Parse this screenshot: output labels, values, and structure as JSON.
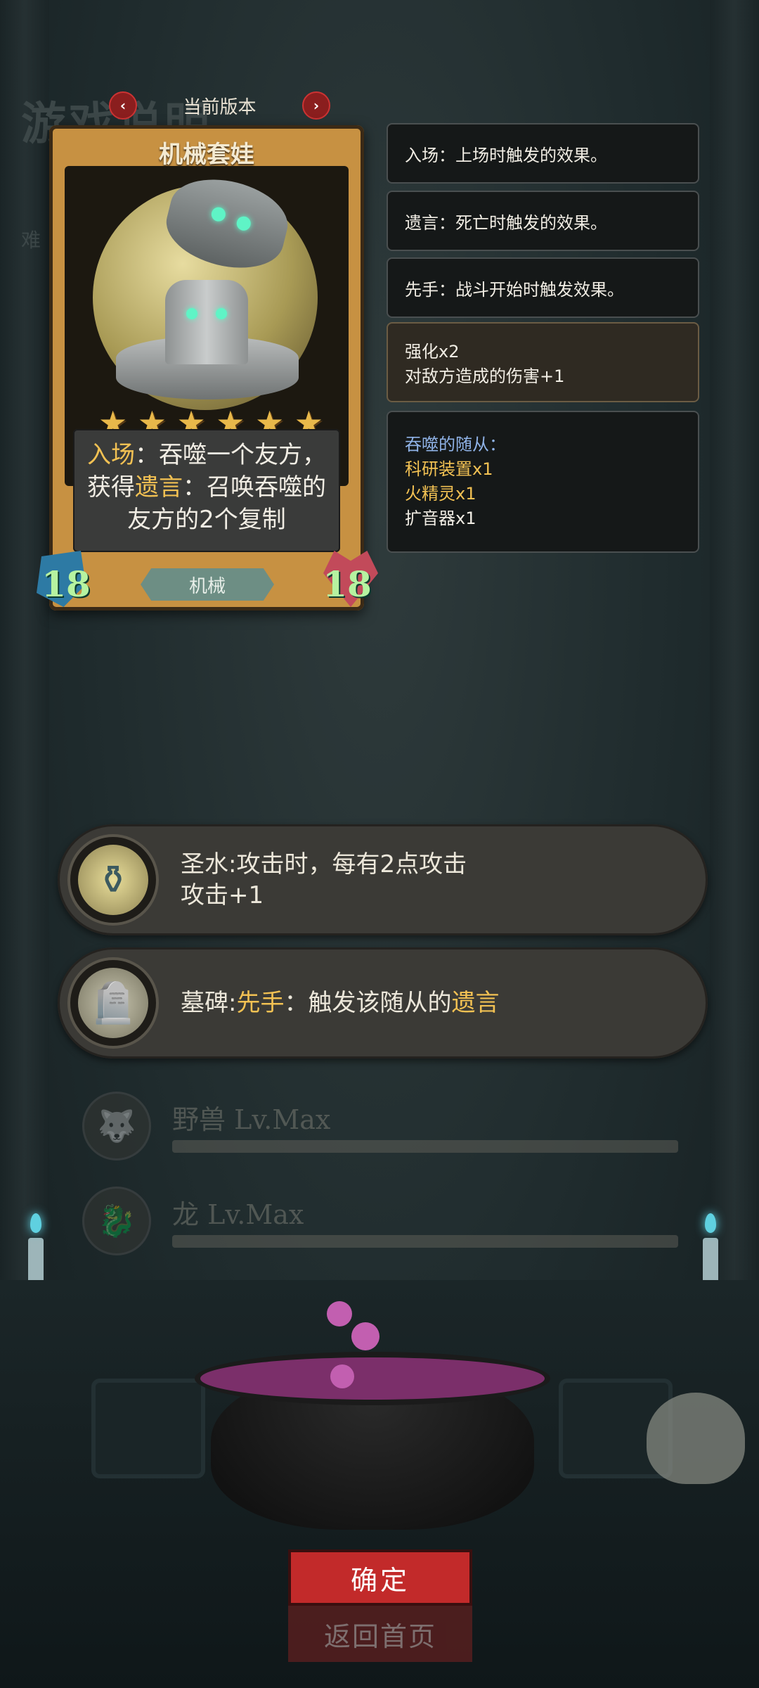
{
  "background": {
    "ghost_title": "游戏说明",
    "ghost_small": "难"
  },
  "version": {
    "label": "当前版本",
    "prev_icon": "‹",
    "next_icon": "›"
  },
  "card": {
    "name": "机械套娃",
    "stars": 6,
    "star_glyph": "★",
    "desc_kw1": "入场",
    "desc_t1": "：吞噬一个友方，",
    "desc_t2": "获得",
    "desc_kw2": "遗言",
    "desc_t3": "：召唤吞噬的",
    "desc_t4": "友方的2个复制",
    "attack": "18",
    "health": "18",
    "tribe": "机械"
  },
  "info_panels": {
    "enter": "入场：上场时触发的效果。",
    "deathrattle": "遗言：死亡时触发的效果。",
    "first_strike": "先手：战斗开始时触发效果。",
    "buff_title": "强化x2",
    "buff_desc": "对敌方造成的伤害+1",
    "devour_title": "吞噬的随从：",
    "devoured": [
      "科研装置x1",
      "火精灵x1",
      "扩音器x1"
    ]
  },
  "buffs": [
    {
      "icon": "holy-water-icon",
      "glyph": "⚱",
      "line1": "圣水:攻击时，每有2点攻击",
      "line2": "攻击+1"
    },
    {
      "icon": "tombstone-icon",
      "glyph": "🪦",
      "name": "墓碑:",
      "kw1": "先手",
      "mid": "：触发该随从的",
      "kw2": "遗言"
    }
  ],
  "tribe_rows": [
    {
      "label": "野兽 Lv.Max",
      "icon": "beast-icon",
      "glyph": "🐺"
    },
    {
      "label": "龙 Lv.Max",
      "icon": "dragon-icon",
      "glyph": "🐉"
    }
  ],
  "buttons": {
    "confirm": "确定",
    "home": "返回首页"
  },
  "colors": {
    "keyword": "#f2c153",
    "confirm_button": "#c22a2a",
    "card_frame": "#c79142"
  }
}
